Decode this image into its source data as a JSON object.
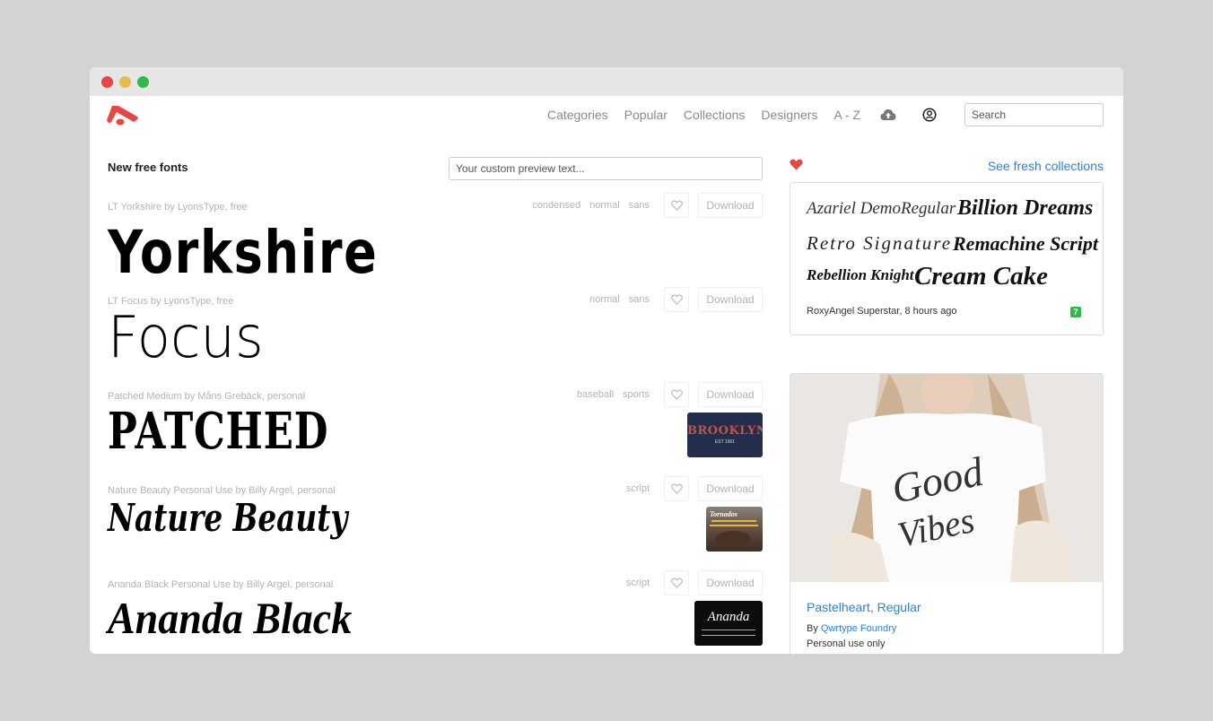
{
  "window": {
    "controls": [
      "close",
      "minimize",
      "maximize"
    ]
  },
  "navbar": {
    "logo": "fontspace-logo",
    "links": [
      {
        "label": "Categories"
      },
      {
        "label": "Popular"
      },
      {
        "label": "Collections"
      },
      {
        "label": "Designers"
      },
      {
        "label": "A - Z"
      }
    ],
    "upload_icon": "cloud-upload-icon",
    "user_icon": "user-circle-icon",
    "search": {
      "placeholder": "Search",
      "value": ""
    }
  },
  "main": {
    "section_title": "New free fonts",
    "preview_input": {
      "placeholder": "Your custom preview text...",
      "value": ""
    },
    "fonts": [
      {
        "meta": "LT Yorkshire by LyonsType, free",
        "tags": [
          "condensed",
          "normal",
          "sans"
        ],
        "preview": "Yorkshire",
        "download_label": "Download",
        "thumbnail": null
      },
      {
        "meta": "LT Focus by LyonsType, free",
        "tags": [
          "normal",
          "sans"
        ],
        "preview": "Focus",
        "download_label": "Download",
        "thumbnail": null
      },
      {
        "meta": "Patched Medium by Måns Grebäck, personal",
        "tags": [
          "baseball",
          "sports"
        ],
        "preview": "PATCHED",
        "download_label": "Download",
        "thumbnail": {
          "title": "BROOKLYN",
          "subtitle": "EST 1901"
        }
      },
      {
        "meta": "Nature Beauty Personal Use by Billy Argel, personal",
        "tags": [
          "script"
        ],
        "preview": "Nature Beauty",
        "download_label": "Download",
        "thumbnail": {
          "title": "Tornados"
        }
      },
      {
        "meta": "Ananda Black Personal Use by Billy Argel, personal",
        "tags": [
          "script"
        ],
        "preview": "Ananda Black",
        "download_label": "Download",
        "thumbnail": {
          "title": "Ananda"
        }
      }
    ]
  },
  "sidebar": {
    "fresh_link": "See fresh collections",
    "collection": {
      "items": [
        "Azariel DemoRegular",
        "Billion Dreams",
        "Retro Signature",
        "Remachine Script",
        "Rebellion Knight",
        "Cream Cake"
      ],
      "author": "RoxyAngel Superstar, 8 hours ago",
      "count": "7"
    },
    "featured": {
      "image_text_1": "Good",
      "image_text_2": "Vibes",
      "title": "Pastelheart, Regular",
      "by_label": "By",
      "designer": "Qwrtype Foundry",
      "license": "Personal use only"
    }
  },
  "colors": {
    "accent": "#e84545",
    "link": "#2a82d8",
    "badge": "#2dbb45"
  }
}
